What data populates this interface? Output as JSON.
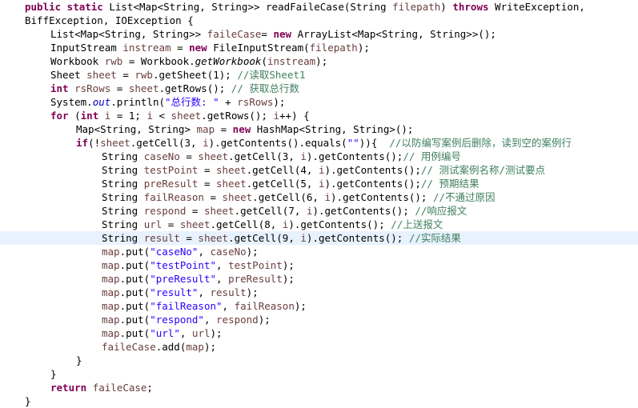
{
  "editor": {
    "current_line_index": 17,
    "lines": [
      {
        "indent": 0,
        "tokens": [
          {
            "t": "public static ",
            "c": "kw"
          },
          {
            "t": "List<Map<String, String>> readFaileCase(String ",
            "c": ""
          },
          {
            "t": "filepath",
            "c": "var"
          },
          {
            "t": ") ",
            "c": ""
          },
          {
            "t": "throws",
            "c": "kw"
          },
          {
            "t": " WriteException,",
            "c": ""
          }
        ]
      },
      {
        "indent": 0,
        "tokens": [
          {
            "t": "BiffException, IOException {",
            "c": ""
          }
        ]
      },
      {
        "indent": 1,
        "tokens": [
          {
            "t": "List<Map<String, String>> ",
            "c": ""
          },
          {
            "t": "faileCase",
            "c": "var"
          },
          {
            "t": "= ",
            "c": ""
          },
          {
            "t": "new",
            "c": "kw"
          },
          {
            "t": " ArrayList<Map<String, String>>();",
            "c": ""
          }
        ]
      },
      {
        "indent": 1,
        "tokens": [
          {
            "t": "InputStream ",
            "c": ""
          },
          {
            "t": "instream",
            "c": "var"
          },
          {
            "t": " = ",
            "c": ""
          },
          {
            "t": "new",
            "c": "kw"
          },
          {
            "t": " FileInputStream(",
            "c": ""
          },
          {
            "t": "filepath",
            "c": "var"
          },
          {
            "t": ");",
            "c": ""
          }
        ]
      },
      {
        "indent": 1,
        "tokens": [
          {
            "t": "Workbook ",
            "c": ""
          },
          {
            "t": "rwb",
            "c": "var"
          },
          {
            "t": " = Workbook.",
            "c": ""
          },
          {
            "t": "getWorkbook",
            "c": "it"
          },
          {
            "t": "(",
            "c": ""
          },
          {
            "t": "instream",
            "c": "var"
          },
          {
            "t": ");",
            "c": ""
          }
        ]
      },
      {
        "indent": 1,
        "tokens": [
          {
            "t": "Sheet ",
            "c": ""
          },
          {
            "t": "sheet",
            "c": "var"
          },
          {
            "t": " = ",
            "c": ""
          },
          {
            "t": "rwb",
            "c": "var"
          },
          {
            "t": ".getSheet(1); ",
            "c": ""
          },
          {
            "t": "//读取Sheet1",
            "c": "cm"
          }
        ]
      },
      {
        "indent": 1,
        "tokens": [
          {
            "t": "int",
            "c": "kw"
          },
          {
            "t": " ",
            "c": ""
          },
          {
            "t": "rsRows",
            "c": "var"
          },
          {
            "t": " = ",
            "c": ""
          },
          {
            "t": "sheet",
            "c": "var"
          },
          {
            "t": ".getRows(); ",
            "c": ""
          },
          {
            "t": "// 获取总行数",
            "c": "cm"
          }
        ]
      },
      {
        "indent": 1,
        "tokens": [
          {
            "t": "System.",
            "c": ""
          },
          {
            "t": "out",
            "c": "fld"
          },
          {
            "t": ".println(",
            "c": ""
          },
          {
            "t": "\"总行数: \"",
            "c": "str"
          },
          {
            "t": " + ",
            "c": ""
          },
          {
            "t": "rsRows",
            "c": "var"
          },
          {
            "t": ");",
            "c": ""
          }
        ]
      },
      {
        "indent": 1,
        "tokens": [
          {
            "t": "for",
            "c": "kw"
          },
          {
            "t": " (",
            "c": ""
          },
          {
            "t": "int",
            "c": "kw"
          },
          {
            "t": " ",
            "c": ""
          },
          {
            "t": "i",
            "c": "var"
          },
          {
            "t": " = 1; ",
            "c": ""
          },
          {
            "t": "i",
            "c": "var"
          },
          {
            "t": " < ",
            "c": ""
          },
          {
            "t": "sheet",
            "c": "var"
          },
          {
            "t": ".getRows(); ",
            "c": ""
          },
          {
            "t": "i",
            "c": "var"
          },
          {
            "t": "++) {",
            "c": ""
          }
        ]
      },
      {
        "indent": 2,
        "tokens": [
          {
            "t": "Map<String, String> ",
            "c": ""
          },
          {
            "t": "map",
            "c": "var"
          },
          {
            "t": " = ",
            "c": ""
          },
          {
            "t": "new",
            "c": "kw"
          },
          {
            "t": " HashMap<String, String>();",
            "c": ""
          }
        ]
      },
      {
        "indent": 2,
        "tokens": [
          {
            "t": "if",
            "c": "kw"
          },
          {
            "t": "(!",
            "c": ""
          },
          {
            "t": "sheet",
            "c": "var"
          },
          {
            "t": ".getCell(3, ",
            "c": ""
          },
          {
            "t": "i",
            "c": "var"
          },
          {
            "t": ").getContents().equals(",
            "c": ""
          },
          {
            "t": "\"\"",
            "c": "str"
          },
          {
            "t": ")){  ",
            "c": ""
          },
          {
            "t": "//以防编写案例后删除，读到空的案例行",
            "c": "cm"
          }
        ]
      },
      {
        "indent": 3,
        "tokens": [
          {
            "t": "String ",
            "c": ""
          },
          {
            "t": "caseNo",
            "c": "var"
          },
          {
            "t": " = ",
            "c": ""
          },
          {
            "t": "sheet",
            "c": "var"
          },
          {
            "t": ".getCell(3, ",
            "c": ""
          },
          {
            "t": "i",
            "c": "var"
          },
          {
            "t": ").getContents();",
            "c": ""
          },
          {
            "t": "// 用例编号",
            "c": "cm"
          }
        ]
      },
      {
        "indent": 3,
        "tokens": [
          {
            "t": "String ",
            "c": ""
          },
          {
            "t": "testPoint",
            "c": "var"
          },
          {
            "t": " = ",
            "c": ""
          },
          {
            "t": "sheet",
            "c": "var"
          },
          {
            "t": ".getCell(4, ",
            "c": ""
          },
          {
            "t": "i",
            "c": "var"
          },
          {
            "t": ").getContents();",
            "c": ""
          },
          {
            "t": "// 测试案例名称/测试要点",
            "c": "cm"
          }
        ]
      },
      {
        "indent": 3,
        "tokens": [
          {
            "t": "String ",
            "c": ""
          },
          {
            "t": "preResult",
            "c": "var"
          },
          {
            "t": " = ",
            "c": ""
          },
          {
            "t": "sheet",
            "c": "var"
          },
          {
            "t": ".getCell(5, ",
            "c": ""
          },
          {
            "t": "i",
            "c": "var"
          },
          {
            "t": ").getContents();",
            "c": ""
          },
          {
            "t": "// 预期结果",
            "c": "cm"
          }
        ]
      },
      {
        "indent": 3,
        "tokens": [
          {
            "t": "String ",
            "c": ""
          },
          {
            "t": "failReason",
            "c": "var"
          },
          {
            "t": " = ",
            "c": ""
          },
          {
            "t": "sheet",
            "c": "var"
          },
          {
            "t": ".getCell(6, ",
            "c": ""
          },
          {
            "t": "i",
            "c": "var"
          },
          {
            "t": ").getContents(); ",
            "c": ""
          },
          {
            "t": "//不通过原因",
            "c": "cm"
          }
        ]
      },
      {
        "indent": 3,
        "tokens": [
          {
            "t": "String ",
            "c": ""
          },
          {
            "t": "respond",
            "c": "var"
          },
          {
            "t": " = ",
            "c": ""
          },
          {
            "t": "sheet",
            "c": "var"
          },
          {
            "t": ".getCell(7, ",
            "c": ""
          },
          {
            "t": "i",
            "c": "var"
          },
          {
            "t": ").getContents(); ",
            "c": ""
          },
          {
            "t": "//响应报文",
            "c": "cm"
          }
        ]
      },
      {
        "indent": 3,
        "tokens": [
          {
            "t": "String ",
            "c": ""
          },
          {
            "t": "url",
            "c": "var"
          },
          {
            "t": " = ",
            "c": ""
          },
          {
            "t": "sheet",
            "c": "var"
          },
          {
            "t": ".getCell(8, ",
            "c": ""
          },
          {
            "t": "i",
            "c": "var"
          },
          {
            "t": ").getContents(); ",
            "c": ""
          },
          {
            "t": "//上送报文",
            "c": "cm"
          }
        ]
      },
      {
        "indent": 3,
        "tokens": [
          {
            "t": "String ",
            "c": ""
          },
          {
            "t": "result",
            "c": "var"
          },
          {
            "t": " = ",
            "c": ""
          },
          {
            "t": "sheet",
            "c": "var"
          },
          {
            "t": ".getCell(9, ",
            "c": ""
          },
          {
            "t": "i",
            "c": "var"
          },
          {
            "t": ").getContents(); ",
            "c": ""
          },
          {
            "t": "//实际结果",
            "c": "cm"
          }
        ]
      },
      {
        "indent": 3,
        "tokens": [
          {
            "t": "map",
            "c": "var"
          },
          {
            "t": ".put(",
            "c": ""
          },
          {
            "t": "\"caseNo\"",
            "c": "str"
          },
          {
            "t": ", ",
            "c": ""
          },
          {
            "t": "caseNo",
            "c": "var"
          },
          {
            "t": ");",
            "c": ""
          }
        ]
      },
      {
        "indent": 3,
        "tokens": [
          {
            "t": "map",
            "c": "var"
          },
          {
            "t": ".put(",
            "c": ""
          },
          {
            "t": "\"testPoint\"",
            "c": "str"
          },
          {
            "t": ", ",
            "c": ""
          },
          {
            "t": "testPoint",
            "c": "var"
          },
          {
            "t": ");",
            "c": ""
          }
        ]
      },
      {
        "indent": 3,
        "tokens": [
          {
            "t": "map",
            "c": "var"
          },
          {
            "t": ".put(",
            "c": ""
          },
          {
            "t": "\"preResult\"",
            "c": "str"
          },
          {
            "t": ", ",
            "c": ""
          },
          {
            "t": "preResult",
            "c": "var"
          },
          {
            "t": ");",
            "c": ""
          }
        ]
      },
      {
        "indent": 3,
        "tokens": [
          {
            "t": "map",
            "c": "var"
          },
          {
            "t": ".put(",
            "c": ""
          },
          {
            "t": "\"result\"",
            "c": "str"
          },
          {
            "t": ", ",
            "c": ""
          },
          {
            "t": "result",
            "c": "var"
          },
          {
            "t": ");",
            "c": ""
          }
        ]
      },
      {
        "indent": 3,
        "tokens": [
          {
            "t": "map",
            "c": "var"
          },
          {
            "t": ".put(",
            "c": ""
          },
          {
            "t": "\"failReason\"",
            "c": "str"
          },
          {
            "t": ", ",
            "c": ""
          },
          {
            "t": "failReason",
            "c": "var"
          },
          {
            "t": ");",
            "c": ""
          }
        ]
      },
      {
        "indent": 3,
        "tokens": [
          {
            "t": "map",
            "c": "var"
          },
          {
            "t": ".put(",
            "c": ""
          },
          {
            "t": "\"respond\"",
            "c": "str"
          },
          {
            "t": ", ",
            "c": ""
          },
          {
            "t": "respond",
            "c": "var"
          },
          {
            "t": ");",
            "c": ""
          }
        ]
      },
      {
        "indent": 3,
        "tokens": [
          {
            "t": "map",
            "c": "var"
          },
          {
            "t": ".put(",
            "c": ""
          },
          {
            "t": "\"url\"",
            "c": "str"
          },
          {
            "t": ", ",
            "c": ""
          },
          {
            "t": "url",
            "c": "var"
          },
          {
            "t": ");",
            "c": ""
          }
        ]
      },
      {
        "indent": 3,
        "tokens": [
          {
            "t": "faileCase",
            "c": "var"
          },
          {
            "t": ".add(",
            "c": ""
          },
          {
            "t": "map",
            "c": "var"
          },
          {
            "t": ");",
            "c": ""
          }
        ]
      },
      {
        "indent": 2,
        "tokens": [
          {
            "t": "}",
            "c": ""
          }
        ]
      },
      {
        "indent": 1,
        "tokens": [
          {
            "t": "}",
            "c": ""
          }
        ]
      },
      {
        "indent": 1,
        "tokens": [
          {
            "t": "return",
            "c": "kw"
          },
          {
            "t": " ",
            "c": ""
          },
          {
            "t": "faileCase",
            "c": "var"
          },
          {
            "t": ";",
            "c": ""
          }
        ]
      },
      {
        "indent": 0,
        "tokens": [
          {
            "t": "}",
            "c": ""
          }
        ]
      }
    ]
  },
  "colors": {
    "background": "#ffffff",
    "keyword": "#7f0055",
    "string": "#2a00ff",
    "comment": "#3f7f5f",
    "local_variable": "#6a3e3e",
    "static_field": "#0000c0",
    "current_line": "#e8f2fe"
  }
}
